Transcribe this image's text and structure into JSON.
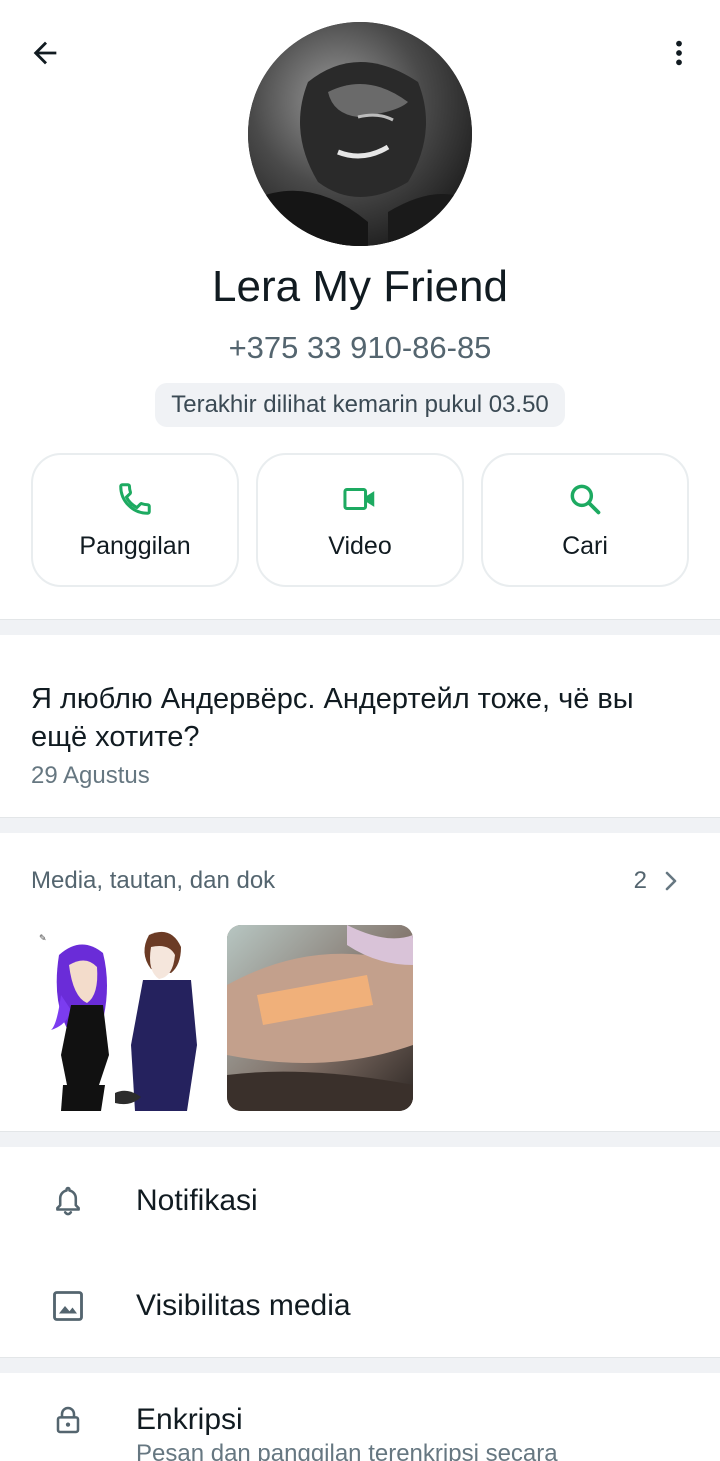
{
  "header": {
    "back_icon": "arrow-left-icon",
    "menu_icon": "more-vert-icon"
  },
  "profile": {
    "name": "Lera My Friend",
    "phone": "+375 33 910-86-85",
    "last_seen": "Terakhir dilihat kemarin pukul 03.50"
  },
  "actions": [
    {
      "label": "Panggilan",
      "icon": "phone-icon"
    },
    {
      "label": "Video",
      "icon": "video-camera-icon"
    },
    {
      "label": "Cari",
      "icon": "search-icon"
    }
  ],
  "about": {
    "text": "Я люблю Андервёрс. Андертейл тоже, чё вы ещё хотите?",
    "date": "29 Agustus"
  },
  "media": {
    "title": "Media, tautan, dan dok",
    "count": "2"
  },
  "settings": {
    "notifications": "Notifikasi",
    "media_visibility": "Visibilitas media",
    "encryption": "Enkripsi",
    "encryption_sub": "Pesan dan panggilan terenkripsi secara"
  },
  "colors": {
    "accent": "#1DAA61",
    "text_primary": "#111B21",
    "text_secondary": "#667781",
    "divider": "#F0F2F5"
  }
}
